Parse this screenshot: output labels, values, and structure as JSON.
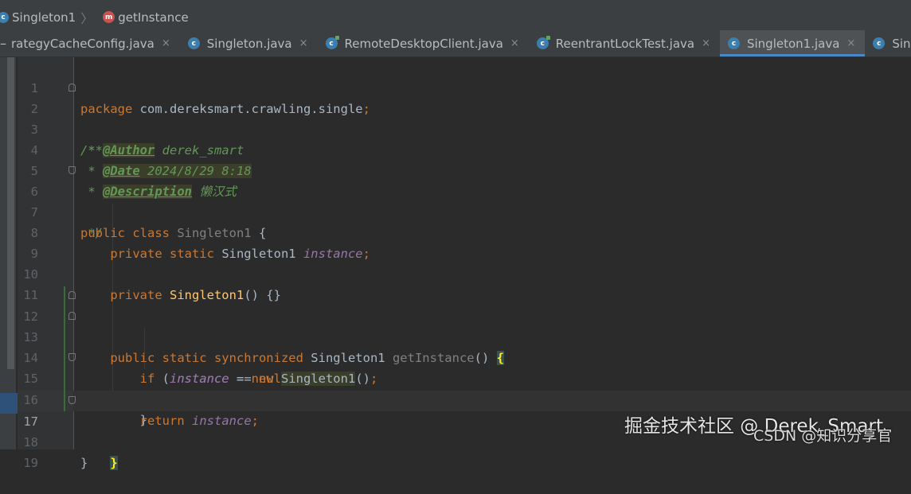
{
  "breadcrumb": {
    "class": "Singleton1",
    "method": "getInstance"
  },
  "tabs": [
    {
      "label": "rategyCacheConfig.java",
      "close": "×"
    },
    {
      "label": "Singleton.java",
      "close": "×"
    },
    {
      "label": "RemoteDesktopClient.java",
      "close": "×"
    },
    {
      "label": "ReentrantLockTest.java",
      "close": "×"
    },
    {
      "label": "Singleton1.java",
      "close": "×"
    },
    {
      "label": "Singleto"
    }
  ],
  "line_numbers": [
    "1",
    "2",
    "3",
    "4",
    "5",
    "6",
    "7",
    "8",
    "9",
    "10",
    "11",
    "12",
    "13",
    "14",
    "15",
    "16",
    "17",
    "18",
    "19"
  ],
  "code": {
    "l1": {
      "kw": "package",
      "pkg": " com.dereksmart.crawling.single",
      "semi": ";"
    },
    "l2": {
      "cmt": "/**"
    },
    "l3": {
      "pre": " * ",
      "tag": "@Author",
      "txt": " derek_smart"
    },
    "l4": {
      "pre": " * ",
      "tag": "@Date",
      "txt": " 2024/8/29 8:18"
    },
    "l5": {
      "pre": " * ",
      "tag": "@Description",
      "txt": " 懒汉式"
    },
    "l6": {
      "cmt": " */"
    },
    "l7": {
      "kw": "public class",
      "cls": " Singleton1",
      "rest": " {"
    },
    "l8": {
      "kw": "    private static",
      "type": " Singleton1 ",
      "fld": "instance",
      "semi": ";"
    },
    "l10": {
      "kw": "    private",
      "mth": " Singleton1",
      "rest": "() {}"
    },
    "l12": {
      "kw": "    public static synchronized",
      "type": " Singleton1 ",
      "mth": "getInstance",
      "rest": "() ",
      "brace": "{"
    },
    "l13": {
      "kw": "        if",
      "p1": " (",
      "fld": "instance",
      "p2": " == ",
      "kw2": "null",
      "p3": ") {"
    },
    "l14": {
      "indent": "            ",
      "fld": "instance",
      "p1": " = ",
      "kw": "new",
      "sp": " ",
      "ctor": "Singleton1",
      "p2": "()",
      "semi": ";"
    },
    "l15": {
      "txt": "        }"
    },
    "l16": {
      "kw": "        return",
      "sp": " ",
      "fld": "instance",
      "semi": ";"
    },
    "l17": {
      "indent": "    ",
      "brace": "}"
    },
    "l18": {
      "txt": "}"
    }
  },
  "watermark": {
    "line1": "掘金技术社区 @ Derek_Smart",
    "line2": "CSDN @知识分享官"
  }
}
